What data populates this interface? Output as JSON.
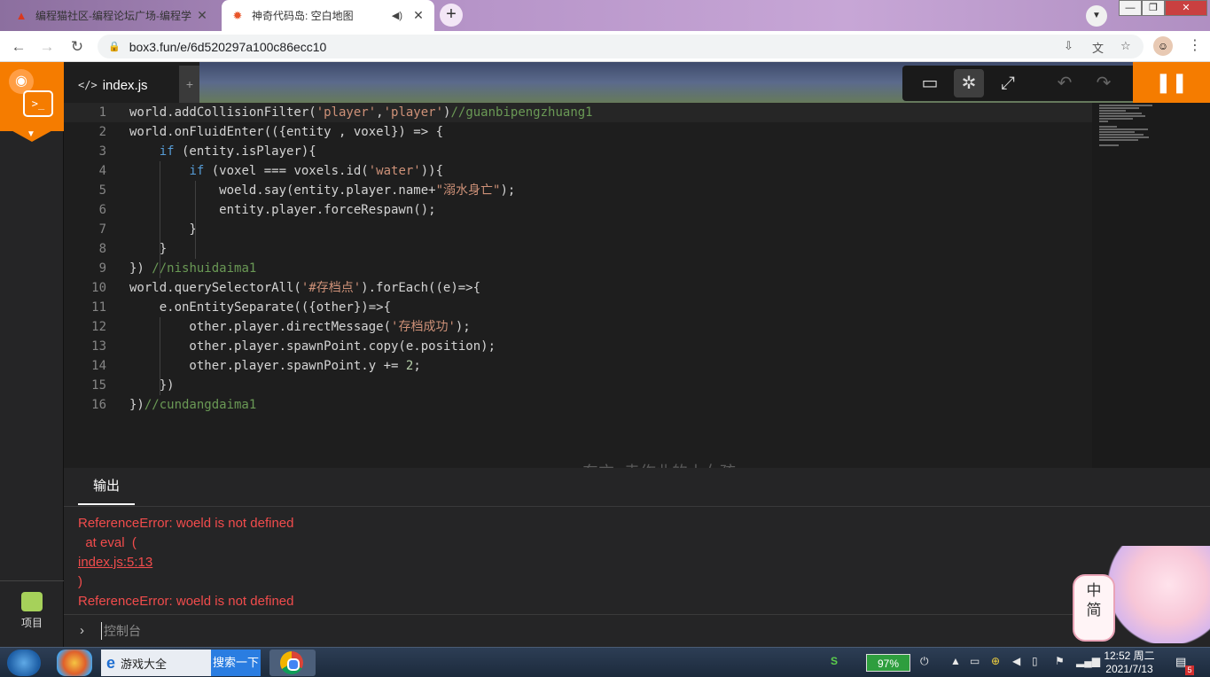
{
  "browser": {
    "tabs": [
      {
        "title": "编程猫社区-编程论坛广场-编程学",
        "favicon": "codemao-icon"
      },
      {
        "title": "神奇代码岛: 空白地图",
        "favicon": "box3-icon",
        "active": true
      }
    ],
    "new_tab": "+",
    "url": "box3.fun/e/6d520297a100c86ecc10"
  },
  "sidebar": {
    "project_label": "项目"
  },
  "editor": {
    "file_tab": "index.js",
    "add_tab": "+",
    "lines": [
      {
        "n": "1",
        "html": "world.addCollisionFilter(<span class=\"str\">'player'</span>,<span class=\"str\">'player'</span>)<span class=\"cm\">//guanbipengzhuang1</span>"
      },
      {
        "n": "2",
        "html": "world.onFluidEnter(({entity , voxel}) => {"
      },
      {
        "n": "3",
        "html": "    <span class=\"kw\">if</span> (entity.isPlayer){"
      },
      {
        "n": "4",
        "html": "        <span class=\"kw\">if</span> (voxel === voxels.id(<span class=\"str\">'water'</span>)){"
      },
      {
        "n": "5",
        "html": "            woeld.say(entity.player.name+<span class=\"str\">\"溺水身亡\"</span>);"
      },
      {
        "n": "6",
        "html": "            entity.player.forceRespawn();"
      },
      {
        "n": "7",
        "html": "        }"
      },
      {
        "n": "8",
        "html": "    }"
      },
      {
        "n": "9",
        "html": "}) <span class=\"cm\">//nishuidaima1</span>"
      },
      {
        "n": "10",
        "html": "world.querySelectorAll(<span class=\"str\">'#存档点'</span>).forEach((e)=>{"
      },
      {
        "n": "11",
        "html": "    e.onEntitySeparate(({other})=>{"
      },
      {
        "n": "12",
        "html": "        other.player.directMessage(<span class=\"str\">'存档成功'</span>);"
      },
      {
        "n": "13",
        "html": "        other.player.spawnPoint.copy(e.position);"
      },
      {
        "n": "14",
        "html": "        other.player.spawnPoint.y += <span class=\"num\">2</span>;"
      },
      {
        "n": "15",
        "html": "    })"
      },
      {
        "n": "16",
        "html": "})<span class=\"cm\">//cundangdaima1</span>"
      }
    ],
    "ghost_text": "东方_卖作业的小女孩"
  },
  "output": {
    "tab_label": "输出",
    "lines": [
      {
        "text": "ReferenceError: woeld is not defined",
        "link": false
      },
      {
        "text": "  at eval  (",
        "link": false
      },
      {
        "text": "index.js:5:13",
        "link": true
      },
      {
        "text": ")",
        "link": false
      },
      {
        "text": "ReferenceError: woeld is not defined",
        "link": false
      }
    ],
    "console_placeholder": "控制台"
  },
  "ime": {
    "label_top": "中",
    "label_bottom": "简"
  },
  "taskbar": {
    "ie_label": "游戏大全",
    "search_label": "搜索一下",
    "battery": "97%",
    "time": "12:52 周二",
    "date": "2021/7/13",
    "notify_count": "5"
  },
  "colors": {
    "accent": "#f57c00",
    "error": "#f14c4c",
    "editor_bg": "#1e1e1e"
  }
}
